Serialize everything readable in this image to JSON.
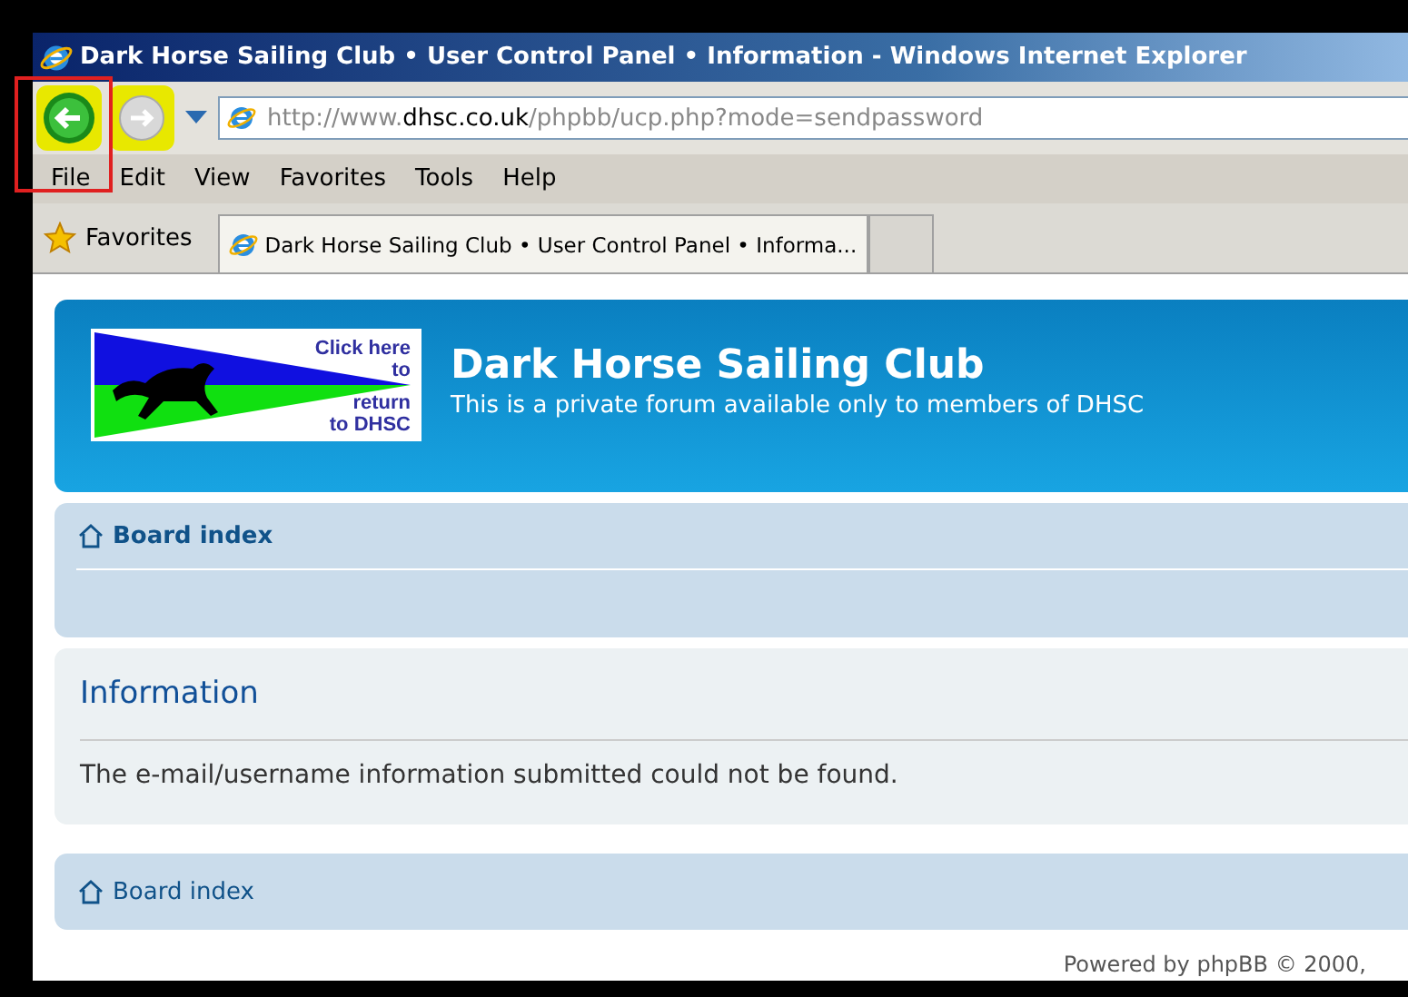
{
  "window": {
    "title": "Dark Horse Sailing Club • User Control Panel • Information - Windows Internet Explorer"
  },
  "address_bar": {
    "url_prefix": "http://www.",
    "url_domain": "dhsc.co.uk",
    "url_path": "/phpbb/ucp.php?mode=sendpassword"
  },
  "menu": [
    "File",
    "Edit",
    "View",
    "Favorites",
    "Tools",
    "Help"
  ],
  "favorites_bar": {
    "label": "Favorites",
    "tabs": [
      {
        "title": "Dark Horse Sailing Club • User Control Panel • Informa...",
        "selected": true
      },
      {
        "selected": false
      }
    ]
  },
  "header": {
    "logo_lines": [
      "Click here",
      "to",
      "return",
      "to DHSC"
    ],
    "site_title": "Dark Horse Sailing Club",
    "description": "This is a private forum available only to members of DHSC"
  },
  "nav_top": {
    "link": "Board index"
  },
  "panel": {
    "heading": "Information",
    "message": "The e-mail/username information submitted could not be found."
  },
  "nav_bottom": {
    "link": "Board index"
  },
  "footer": "Powered by phpBB © 2000,"
}
